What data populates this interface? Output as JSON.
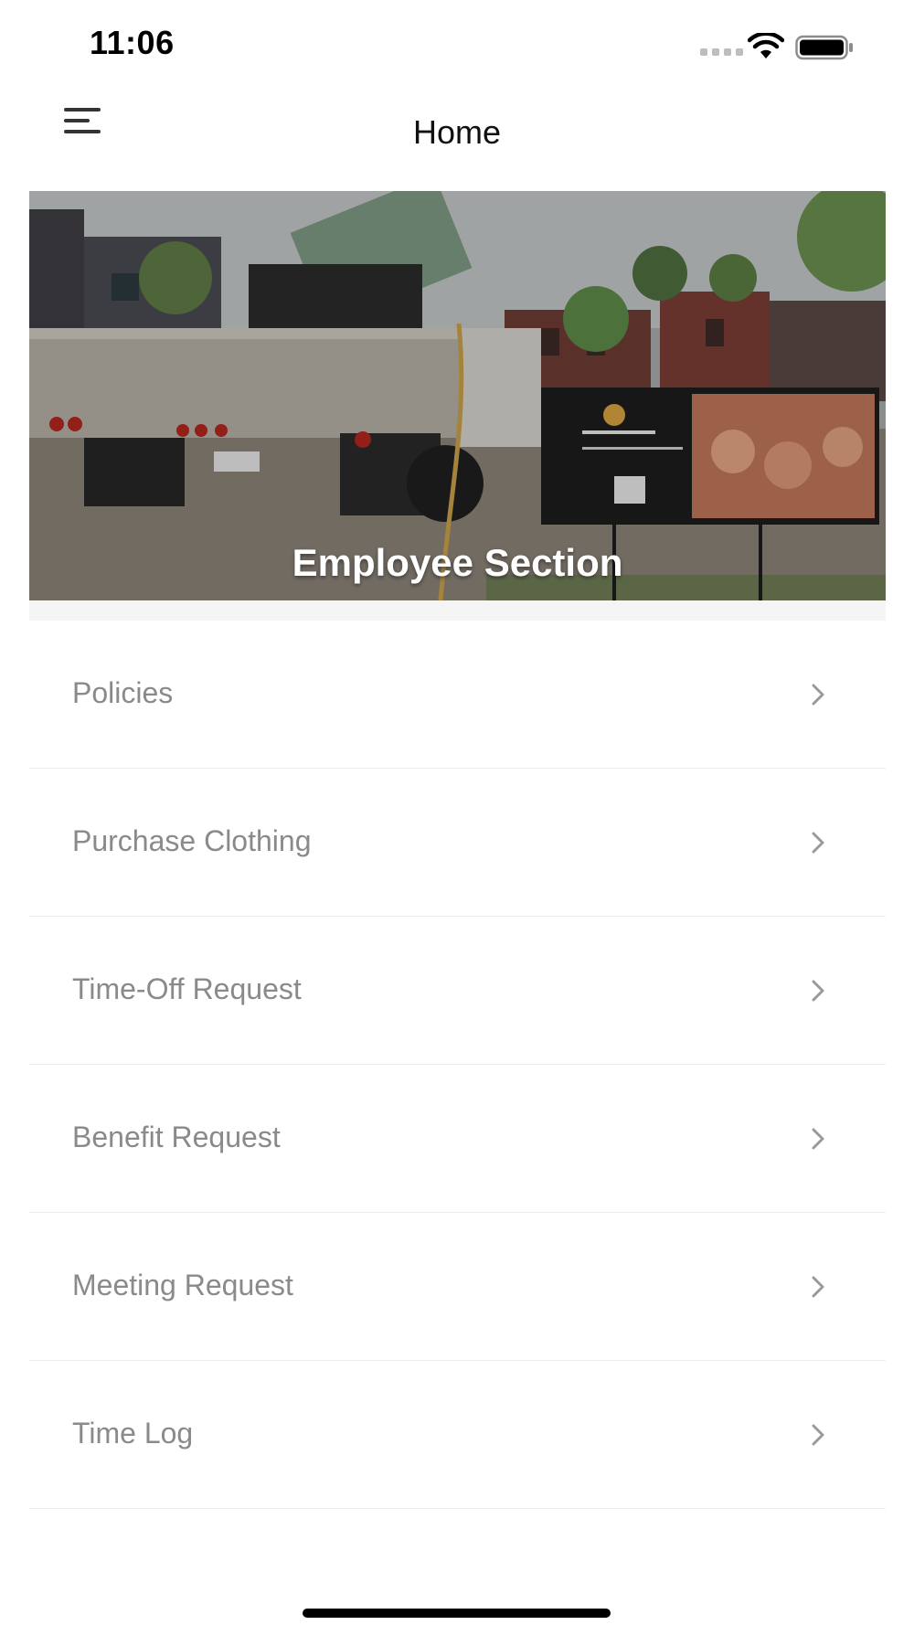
{
  "status_bar": {
    "time": "11:06",
    "icons": [
      "cellular-signal-icon",
      "wifi-icon",
      "battery-icon"
    ]
  },
  "nav": {
    "menu_icon": "hamburger-menu-icon",
    "title": "Home"
  },
  "hero": {
    "caption": "Employee Section",
    "image_description_icon": "banner-photo"
  },
  "menu": {
    "items": [
      {
        "label": "Policies",
        "icon": "chevron-right-icon"
      },
      {
        "label": "Purchase Clothing",
        "icon": "chevron-right-icon"
      },
      {
        "label": "Time-Off Request",
        "icon": "chevron-right-icon"
      },
      {
        "label": "Benefit Request",
        "icon": "chevron-right-icon"
      },
      {
        "label": "Meeting Request",
        "icon": "chevron-right-icon"
      },
      {
        "label": "Time Log",
        "icon": "chevron-right-icon"
      }
    ]
  },
  "colors": {
    "label": "#8a8a8a",
    "chevron": "#9a9a9a",
    "divider": "#ececec"
  }
}
